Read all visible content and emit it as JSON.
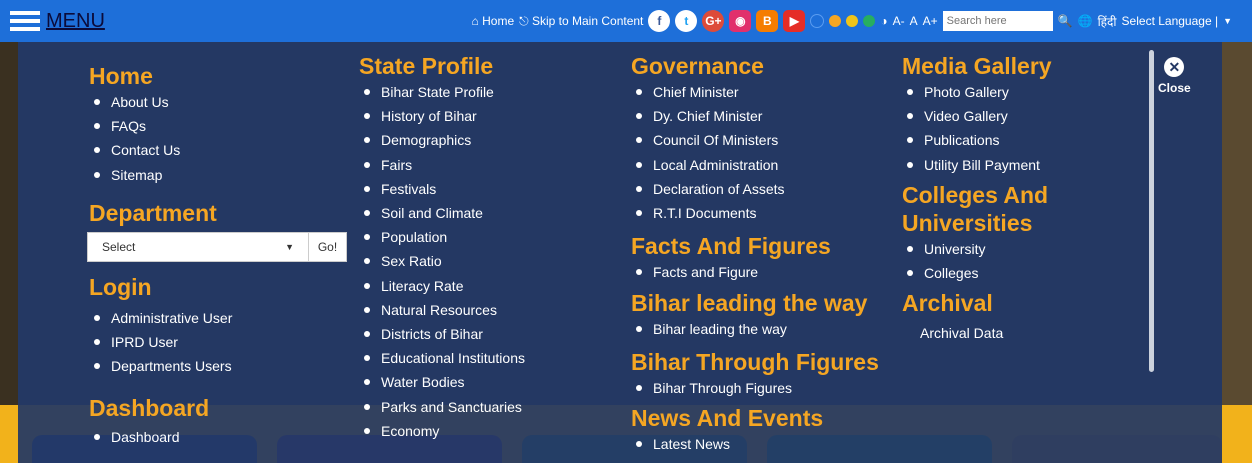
{
  "topbar": {
    "menu_label": "MENU",
    "home_label": "Home",
    "skip_label": "Skip to Main Content",
    "font_small": "A-",
    "font_normal": "A",
    "font_large": "A+",
    "search_placeholder": "Search here",
    "hindi_label": "हिंदी",
    "select_language": "Select Language |",
    "social_icons": [
      "facebook-icon",
      "twitter-icon",
      "google-plus-icon",
      "instagram-icon",
      "blogger-icon",
      "youtube-icon"
    ],
    "theme_colors": [
      "#1e6fd9",
      "#f5a623",
      "#f0c419",
      "#27ae60"
    ]
  },
  "menu": {
    "home": {
      "title": "Home",
      "items": [
        "About Us",
        "FAQs",
        "Contact Us",
        "Sitemap"
      ]
    },
    "department": {
      "title": "Department",
      "select_value": "Select",
      "go_label": "Go!"
    },
    "login": {
      "title": "Login",
      "items": [
        "Administrative User",
        "IPRD User",
        "Departments Users"
      ]
    },
    "dashboard": {
      "title": "Dashboard",
      "items": [
        "Dashboard"
      ]
    },
    "state_profile": {
      "title": "State Profile",
      "items": [
        "Bihar State Profile",
        "History of Bihar",
        "Demographics",
        "Fairs",
        "Festivals",
        "Soil and Climate",
        "Population",
        "Sex Ratio",
        "Literacy Rate",
        "Natural Resources",
        "Districts of Bihar",
        "Educational Institutions",
        "Water Bodies",
        "Parks and Sanctuaries",
        "Economy"
      ]
    },
    "governance": {
      "title": "Governance",
      "items": [
        "Chief Minister",
        "Dy. Chief Minister",
        "Council Of Ministers",
        "Local Administration",
        "Declaration of Assets",
        "R.T.I Documents"
      ]
    },
    "facts": {
      "title": "Facts And Figures",
      "items": [
        "Facts and Figure"
      ]
    },
    "leading": {
      "title": "Bihar leading the way",
      "items": [
        "Bihar leading the way"
      ]
    },
    "through": {
      "title": "Bihar Through Figures",
      "items": [
        "Bihar Through Figures"
      ]
    },
    "news": {
      "title": "News And Events",
      "items": [
        "Latest News"
      ]
    },
    "media": {
      "title": "Media Gallery",
      "items": [
        "Photo Gallery",
        "Video Gallery",
        "Publications",
        "Utility Bill Payment"
      ]
    },
    "colleges": {
      "title_line1": "Colleges And",
      "title_line2": "Universities",
      "items": [
        "University",
        "Colleges"
      ]
    },
    "archival": {
      "title": "Archival",
      "link": "Archival Data"
    },
    "close_label": "Close"
  },
  "colors": {
    "accent": "#f5a623",
    "topbar": "#1e6fd9",
    "overlay": "#243864",
    "footer_band": "#f2b21b"
  }
}
